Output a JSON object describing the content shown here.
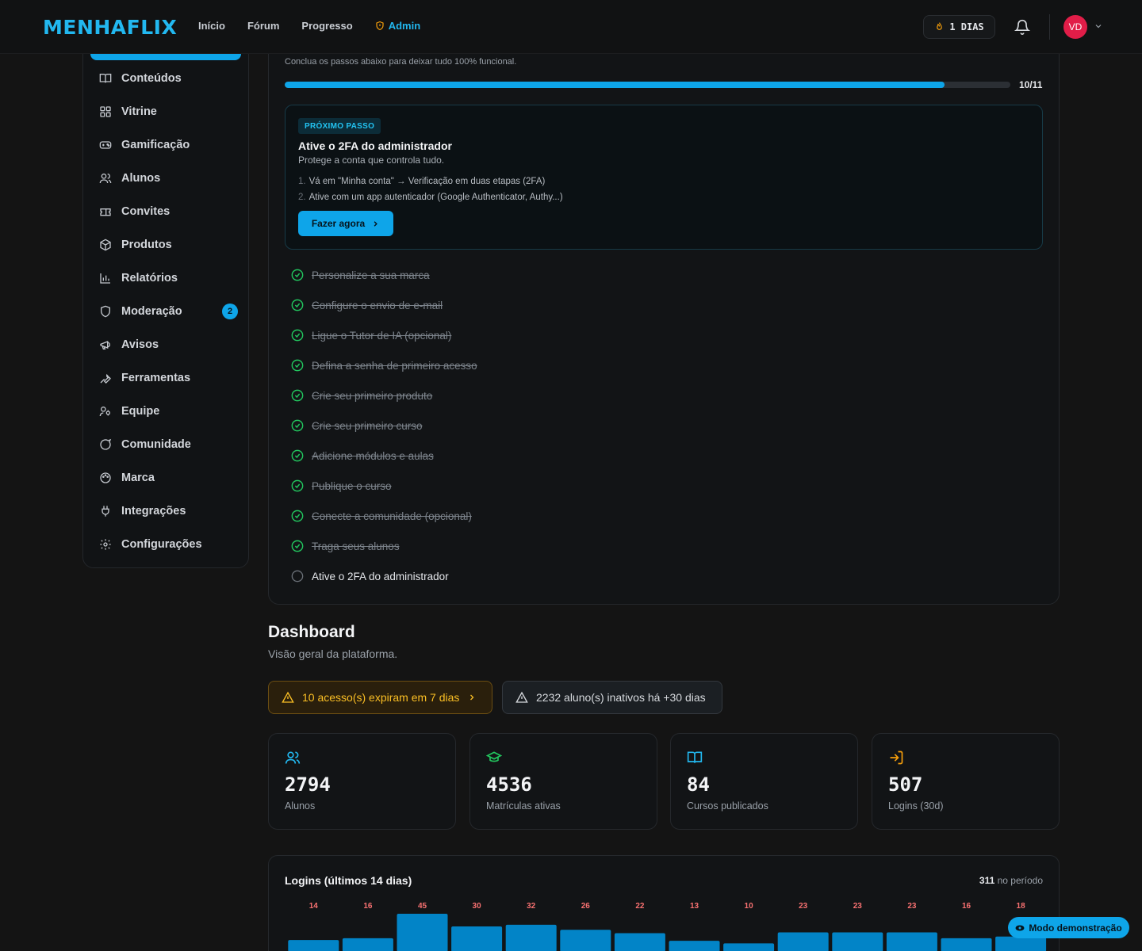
{
  "brand": {
    "logo": "MENHAFLIX",
    "accent": "#0ea5e9"
  },
  "nav": {
    "items": [
      "Início",
      "Fórum",
      "Progresso"
    ],
    "admin": "Admin"
  },
  "header": {
    "streak": "1 DIAS",
    "avatar": "VD"
  },
  "sidebar": {
    "items": [
      {
        "label": "Conteúdos",
        "icon": "book-open-icon"
      },
      {
        "label": "Vitrine",
        "icon": "grid-icon"
      },
      {
        "label": "Gamificação",
        "icon": "gamepad-icon"
      },
      {
        "label": "Alunos",
        "icon": "users-icon"
      },
      {
        "label": "Convites",
        "icon": "ticket-icon"
      },
      {
        "label": "Produtos",
        "icon": "package-icon"
      },
      {
        "label": "Relatórios",
        "icon": "bar-chart-icon"
      },
      {
        "label": "Moderação",
        "icon": "shield-icon",
        "badge": "2"
      },
      {
        "label": "Avisos",
        "icon": "megaphone-icon"
      },
      {
        "label": "Ferramentas",
        "icon": "wrench-icon"
      },
      {
        "label": "Equipe",
        "icon": "team-icon"
      },
      {
        "label": "Comunidade",
        "icon": "chat-icon"
      },
      {
        "label": "Marca",
        "icon": "palette-icon"
      },
      {
        "label": "Integrações",
        "icon": "plug-icon"
      },
      {
        "label": "Configurações",
        "icon": "gear-icon"
      }
    ]
  },
  "onboarding": {
    "subtitle": "Conclua os passos abaixo para deixar tudo 100% funcional.",
    "progress": 0.909,
    "count": "10/11",
    "next_step": {
      "tag": "PRÓXIMO PASSO",
      "title": "Ative o 2FA do administrador",
      "description": "Protege a conta que controla tudo.",
      "steps": [
        {
          "num": "1.",
          "text": "Vá em \"Minha conta\" → Verificação em duas etapas (2FA)"
        },
        {
          "num": "2.",
          "text": "Ative com um app autenticador (Google Authenticator, Authy...)"
        }
      ],
      "button": "Fazer agora"
    },
    "checklist": [
      {
        "label": "Personalize a sua marca",
        "done": true
      },
      {
        "label": "Configure o envio de e-mail",
        "done": true
      },
      {
        "label": "Ligue o Tutor de IA (opcional)",
        "done": true
      },
      {
        "label": "Defina a senha de primeiro acesso",
        "done": true
      },
      {
        "label": "Crie seu primeiro produto",
        "done": true
      },
      {
        "label": "Crie seu primeiro curso",
        "done": true
      },
      {
        "label": "Adicione módulos e aulas",
        "done": true
      },
      {
        "label": "Publique o curso",
        "done": true
      },
      {
        "label": "Conecte a comunidade (opcional)",
        "done": true
      },
      {
        "label": "Traga seus alunos",
        "done": true
      },
      {
        "label": "Ative o 2FA do administrador",
        "done": false
      }
    ]
  },
  "dashboard": {
    "title": "Dashboard",
    "subtitle": "Visão geral da plataforma.",
    "alerts": {
      "warning": "10 acesso(s) expiram em 7 dias",
      "info": "2232 aluno(s) inativos há +30 dias"
    },
    "stats": [
      {
        "value": "2794",
        "label": "Alunos",
        "icon": "users-icon",
        "color": "#22b8f0"
      },
      {
        "value": "4536",
        "label": "Matrículas ativas",
        "icon": "graduation-cap-icon",
        "color": "#22c55e"
      },
      {
        "value": "84",
        "label": "Cursos publicados",
        "icon": "book-open-icon",
        "color": "#22b8f0"
      },
      {
        "value": "507",
        "label": "Logins (30d)",
        "icon": "log-in-icon",
        "color": "#f59e0b"
      }
    ]
  },
  "chart_data": {
    "type": "bar",
    "title": "Logins (últimos 14 dias)",
    "total": "311",
    "total_suffix": "no período",
    "values": [
      14,
      16,
      45,
      30,
      32,
      26,
      22,
      13,
      10,
      23,
      23,
      23,
      16,
      18
    ],
    "label_color": "#f87171",
    "bar_color": "#0284c7"
  },
  "footer": {
    "demo_mode": "Modo demonstração"
  }
}
